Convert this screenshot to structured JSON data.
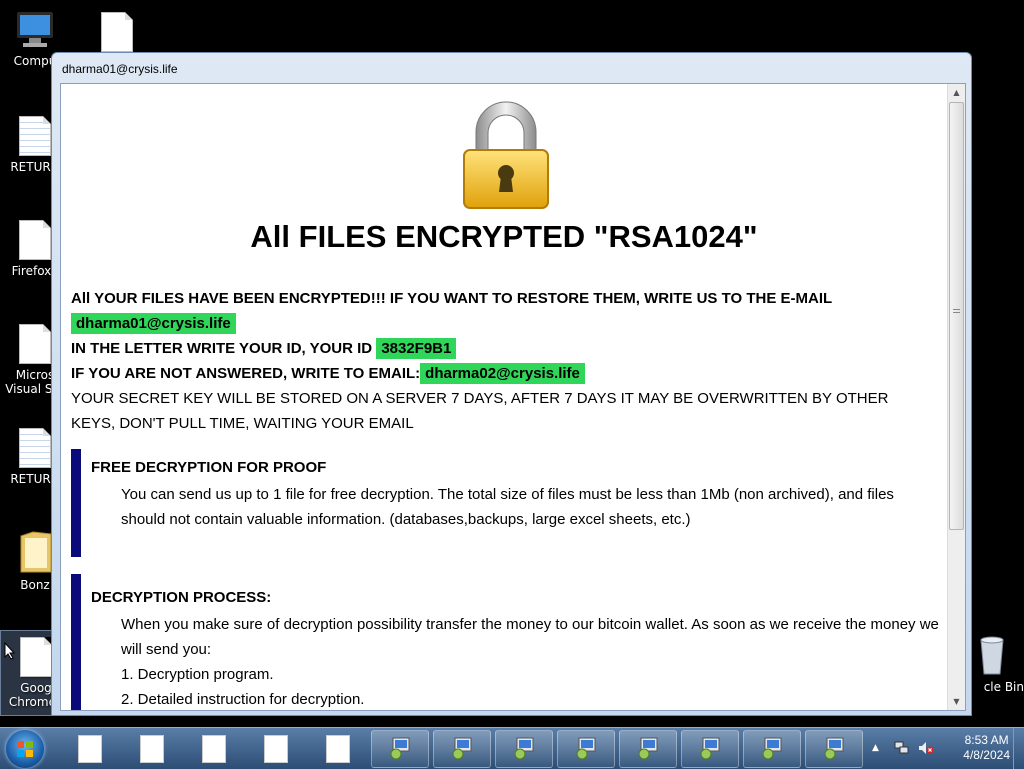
{
  "desktop": {
    "icons": [
      {
        "label": "Compu"
      },
      {
        "label": ""
      },
      {
        "label": "RETURN"
      },
      {
        "label": "Firefox.l"
      },
      {
        "label": "Micros",
        "label2": "Visual Stu"
      },
      {
        "label": "RETURN"
      },
      {
        "label": "Bonz"
      },
      {
        "label": "Goog",
        "label2": "Chrome.l"
      },
      {
        "label": "cle Bin"
      }
    ]
  },
  "window": {
    "title": "dharma01@crysis.life"
  },
  "note": {
    "headline": "All FILES ENCRYPTED \"RSA1024\"",
    "line1": "All YOUR FILES HAVE BEEN ENCRYPTED!!! IF YOU WANT TO RESTORE THEM, WRITE US TO THE E-MAIL",
    "email1": "dharma01@crysis.life",
    "id_prefix": "IN THE LETTER WRITE YOUR ID, YOUR ID",
    "id_value": "3832F9B1",
    "alt_prefix": "IF YOU ARE NOT ANSWERED, WRITE TO EMAIL:",
    "email2": "dharma02@crysis.life",
    "secret_key": "YOUR SECRET KEY WILL BE STORED ON A SERVER 7 DAYS, AFTER 7 DAYS IT MAY BE OVERWRITTEN BY OTHER KEYS, DON'T PULL TIME, WAITING YOUR EMAIL",
    "section1": {
      "heading": "FREE DECRYPTION FOR PROOF",
      "body": "You can send us up to 1 file for free decryption. The total size of files must be less than 1Mb (non archived), and files should not contain valuable information. (databases,backups, large excel sheets, etc.)"
    },
    "section2": {
      "heading": "DECRYPTION PROCESS:",
      "body": "When you make sure of decryption possibility transfer the money to our bitcoin wallet. As soon as we receive the money we will send you:",
      "item1": "1. Decryption program.",
      "item2": "2. Detailed instruction for decryption."
    }
  },
  "taskbar": {
    "time": "8:53 AM",
    "date": "4/8/2024"
  },
  "colors": {
    "highlight": "#2fd65a",
    "section_bar": "#0a0a7a"
  }
}
